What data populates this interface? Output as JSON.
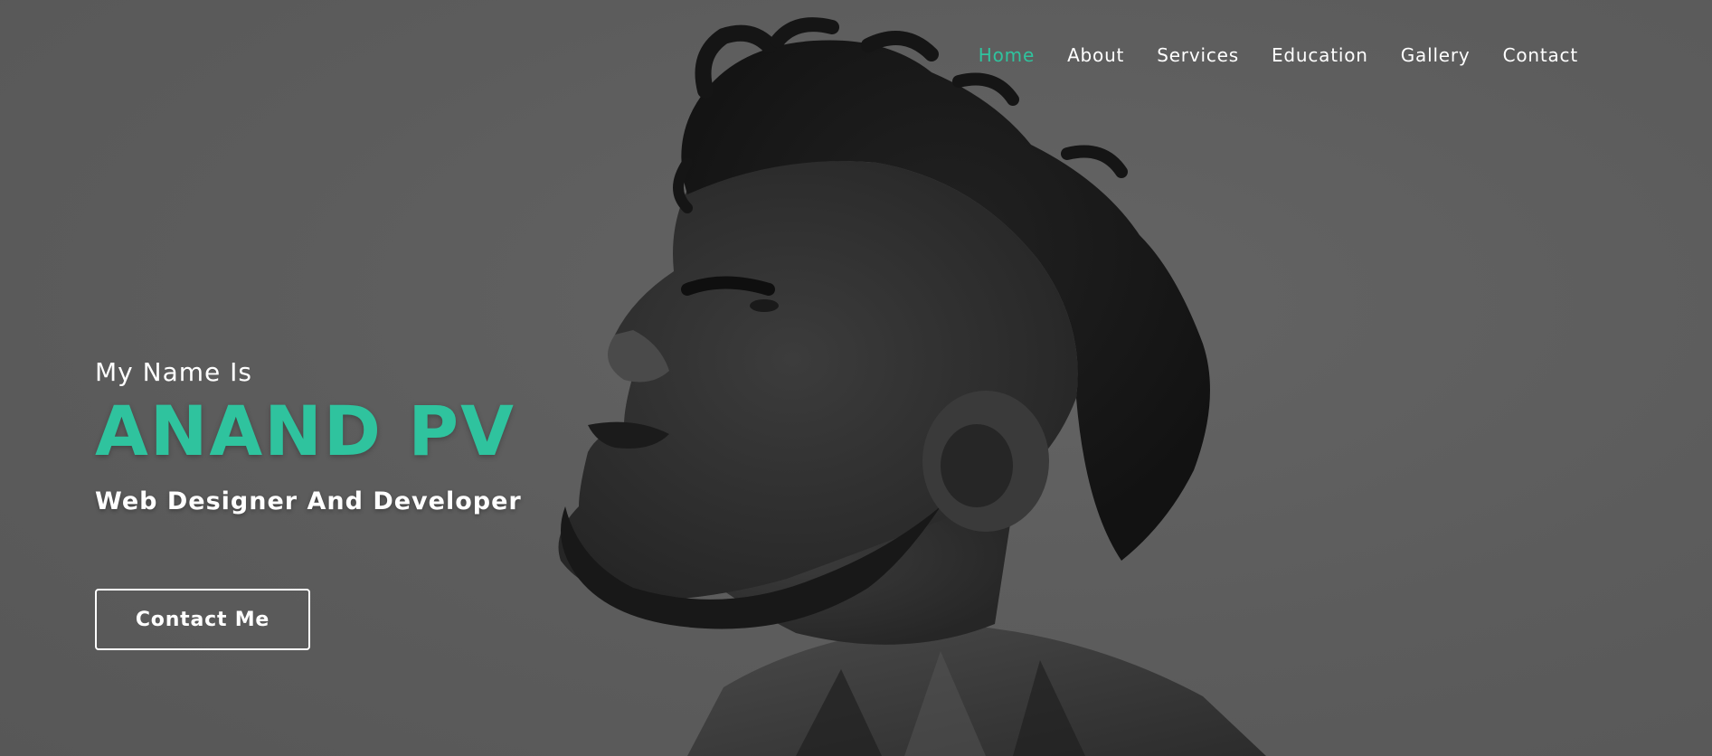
{
  "nav": {
    "items": [
      {
        "label": "Home",
        "active": true
      },
      {
        "label": "About",
        "active": false
      },
      {
        "label": "Services",
        "active": false
      },
      {
        "label": "Education",
        "active": false
      },
      {
        "label": "Gallery",
        "active": false
      },
      {
        "label": "Contact",
        "active": false
      }
    ]
  },
  "hero": {
    "prefix": "My Name Is",
    "name": "ANAND PV",
    "role": "Web Designer And Developer",
    "cta_label": "Contact Me"
  },
  "colors": {
    "accent": "#2fc39e",
    "background": "#5e5e5e",
    "text": "#ffffff"
  }
}
